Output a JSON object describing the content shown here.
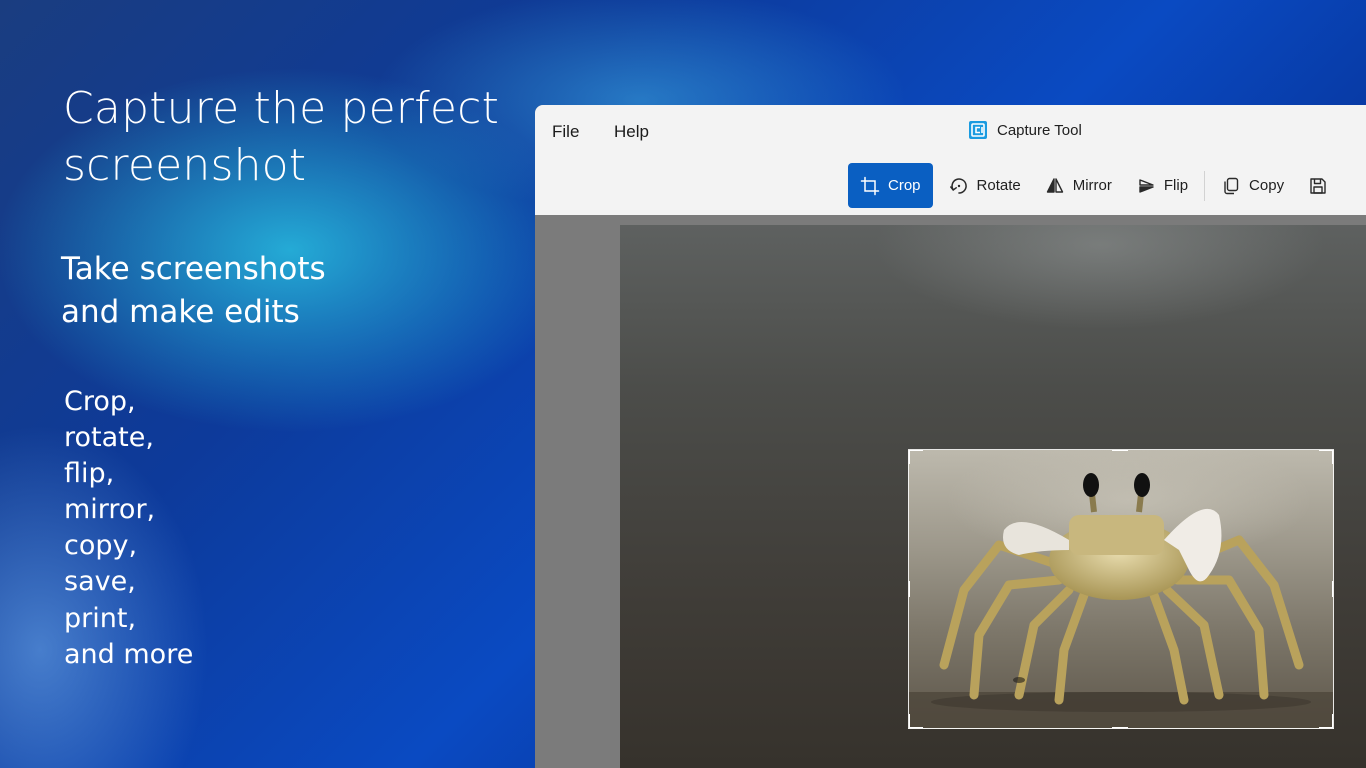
{
  "promo": {
    "title": "Capture the perfect screenshot",
    "subtitle": "Take screenshots and make edits",
    "features": [
      "Crop,",
      "rotate,",
      "flip,",
      "mirror,",
      "copy,",
      "save,",
      "print,",
      "and more"
    ]
  },
  "app": {
    "title": "Capture Tool",
    "menu": {
      "file": "File",
      "help": "Help"
    },
    "toolbar": {
      "crop": "Crop",
      "rotate": "Rotate",
      "mirror": "Mirror",
      "flip": "Flip",
      "copy": "Copy"
    },
    "active_tool": "Crop",
    "accent_color": "#0a5fc2"
  },
  "icons": {
    "app_logo": "capture-tool-logo-icon",
    "crop": "crop-icon",
    "rotate": "rotate-icon",
    "mirror": "mirror-icon",
    "flip": "flip-icon",
    "copy": "copy-icon",
    "save": "save-icon"
  }
}
